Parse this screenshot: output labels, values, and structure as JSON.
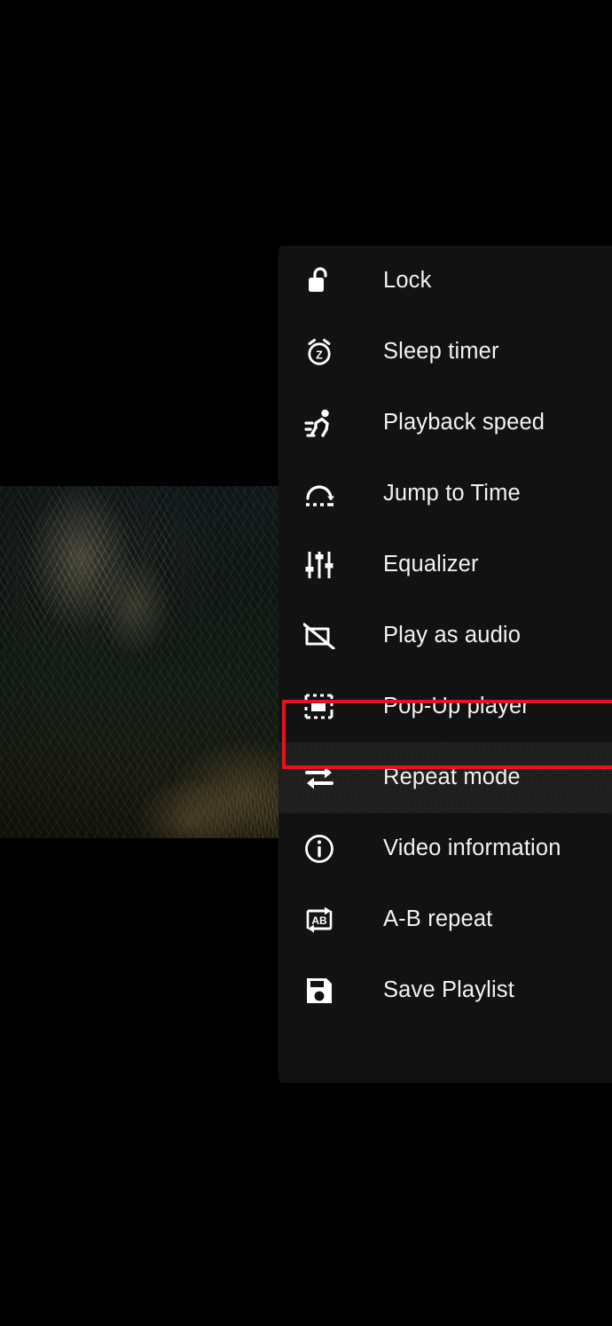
{
  "app": {
    "screen_background": "#000000",
    "menu_background": "#121212",
    "text_color": "#f2f2f2",
    "highlight_color": "#e81123"
  },
  "video": {
    "name": "video-playback-surface",
    "description": "dark forest scene with conifers and a grassy trail"
  },
  "menu": {
    "name": "player-options-menu",
    "items": [
      {
        "icon": "lock-open-icon",
        "label": "Lock",
        "state": "normal"
      },
      {
        "icon": "alarm-sleep-timer-icon",
        "label": "Sleep timer",
        "state": "normal"
      },
      {
        "icon": "running-person-icon",
        "label": "Playback speed",
        "state": "normal"
      },
      {
        "icon": "jump-to-time-icon",
        "label": "Jump to Time",
        "state": "normal"
      },
      {
        "icon": "equalizer-sliders-icon",
        "label": "Equalizer",
        "state": "normal"
      },
      {
        "icon": "video-off-icon",
        "label": "Play as audio",
        "state": "normal"
      },
      {
        "icon": "picture-in-picture-icon",
        "label": "Pop-Up player",
        "state": "highlighted"
      },
      {
        "icon": "repeat-arrows-icon",
        "label": "Repeat mode",
        "state": "pressed"
      },
      {
        "icon": "info-circle-icon",
        "label": "Video information",
        "state": "normal"
      },
      {
        "icon": "ab-repeat-icon",
        "label": "A-B repeat",
        "state": "normal"
      },
      {
        "icon": "floppy-save-icon",
        "label": "Save Playlist",
        "state": "normal"
      }
    ]
  },
  "annotation": {
    "name": "pop-up-player-highlight",
    "target_label": "Pop-Up player",
    "color": "#e81123"
  }
}
